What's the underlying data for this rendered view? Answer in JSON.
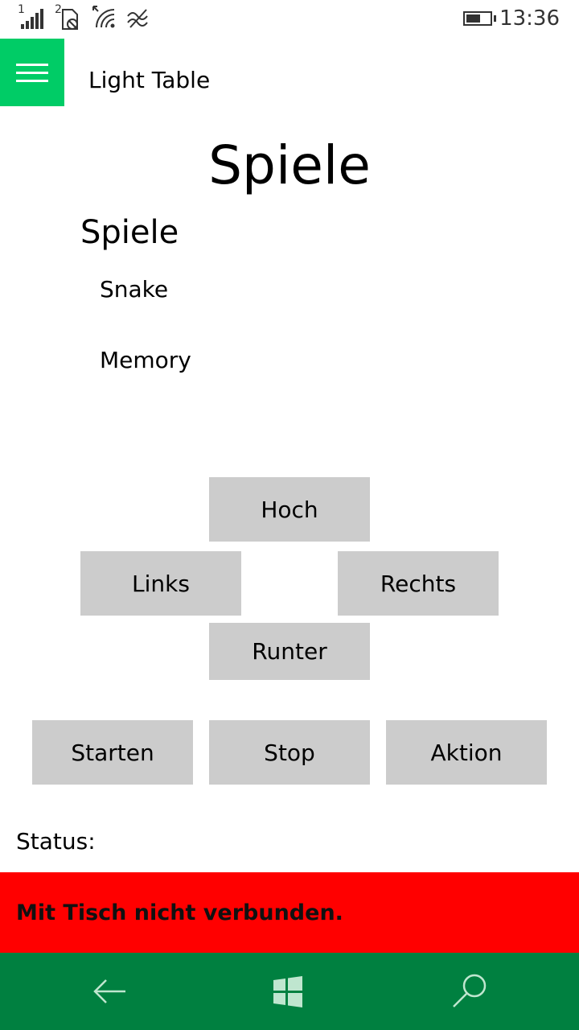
{
  "status_bar": {
    "time": "13:36",
    "signal_sim1_label": "1",
    "signal_sim2_label": "2",
    "battery_level": 0.6,
    "icons": [
      "signal-icon",
      "sim2-no-signal-icon",
      "wifi-icon",
      "data-saver-icon",
      "battery-icon"
    ]
  },
  "header": {
    "menu_icon": "hamburger-icon",
    "app_title": "Light Table",
    "accent_color": "#00cc66"
  },
  "main": {
    "page_title": "Spiele",
    "section_title": "Spiele",
    "games": [
      "Snake",
      "Memory"
    ]
  },
  "controls": {
    "up": "Hoch",
    "left": "Links",
    "right": "Rechts",
    "down": "Runter"
  },
  "actions": {
    "start": "Starten",
    "stop": "Stop",
    "action": "Aktion"
  },
  "status": {
    "label": "Status:",
    "message": "Mit Tisch nicht verbunden.",
    "message_bg": "#ff0000"
  },
  "navbar": {
    "bg": "#008040",
    "icons": [
      "back-arrow-icon",
      "windows-logo-icon",
      "search-icon"
    ]
  }
}
